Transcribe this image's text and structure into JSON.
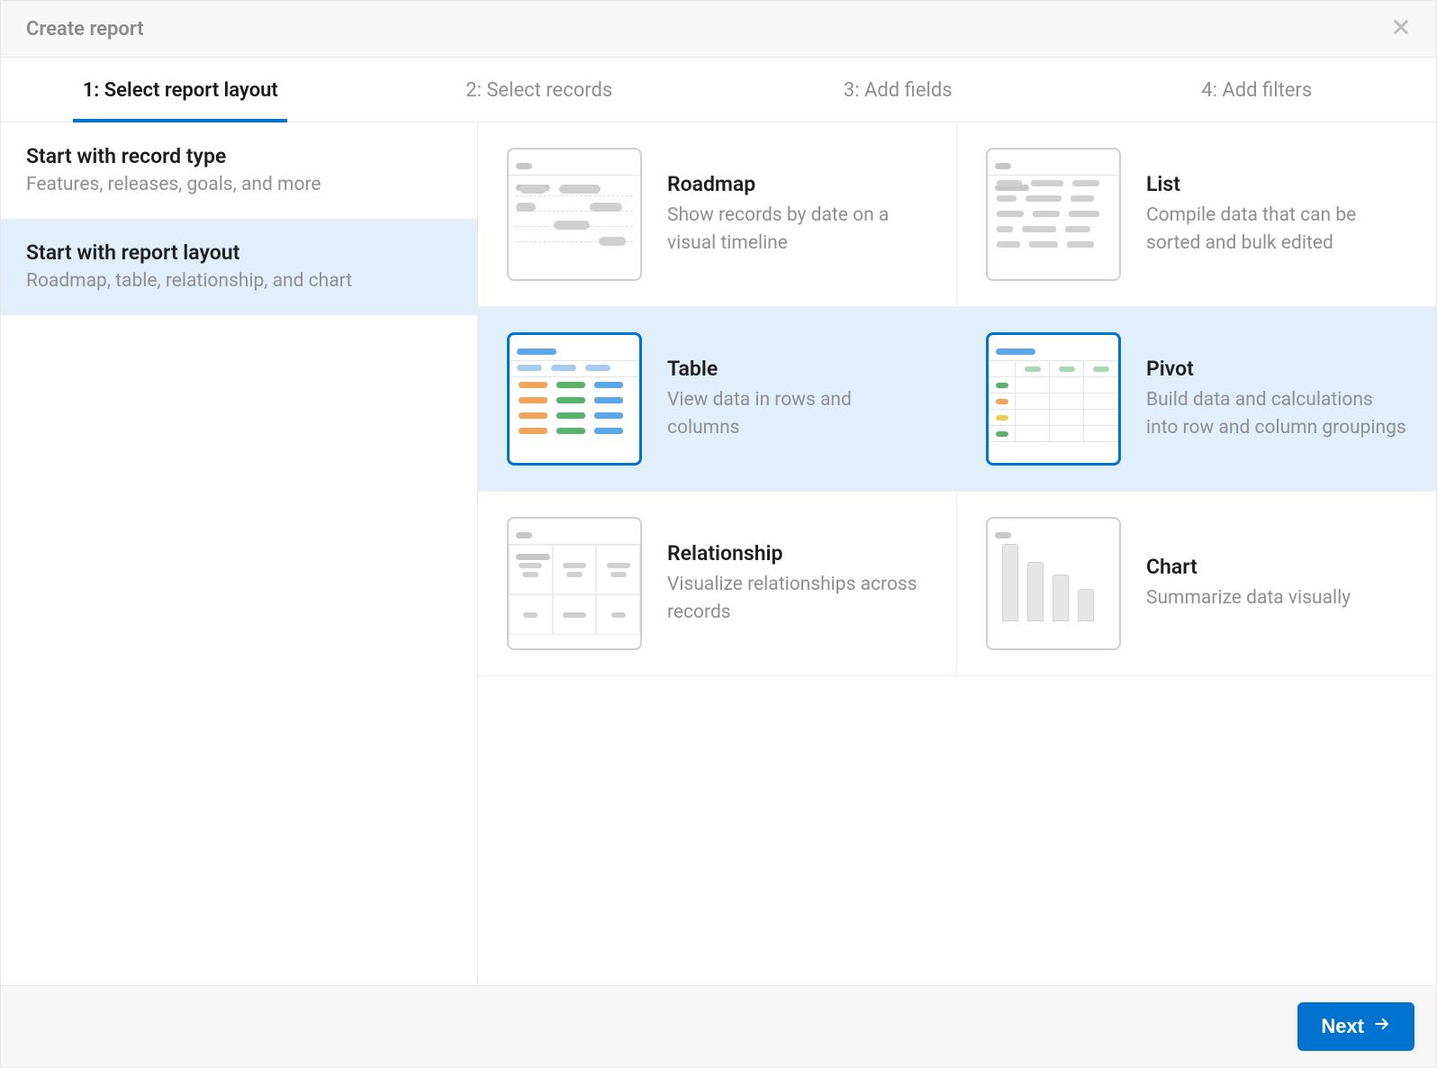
{
  "header": {
    "title": "Create report"
  },
  "steps": [
    {
      "label": "1: Select report layout",
      "active": true
    },
    {
      "label": "2: Select records",
      "active": false
    },
    {
      "label": "3: Add fields",
      "active": false
    },
    {
      "label": "4: Add filters",
      "active": false
    }
  ],
  "sidebar": {
    "options": [
      {
        "title": "Start with record type",
        "desc": "Features, releases, goals, and more",
        "selected": false
      },
      {
        "title": "Start with report layout",
        "desc": "Roadmap, table, relationship, and chart",
        "selected": true
      }
    ]
  },
  "layouts": [
    {
      "key": "roadmap",
      "name": "Roadmap",
      "desc": "Show records by date on a visual timeline",
      "selected": false
    },
    {
      "key": "list",
      "name": "List",
      "desc": "Compile data that can be sorted and bulk edited",
      "selected": false
    },
    {
      "key": "table",
      "name": "Table",
      "desc": "View data in rows and columns",
      "selected": true
    },
    {
      "key": "pivot",
      "name": "Pivot",
      "desc": "Build data and calculations into row and column groupings",
      "selected": true
    },
    {
      "key": "relationship",
      "name": "Relationship",
      "desc": "Visualize relationships across records",
      "selected": false
    },
    {
      "key": "chart",
      "name": "Chart",
      "desc": "Summarize data visually",
      "selected": false
    }
  ],
  "footer": {
    "next_label": "Next"
  }
}
